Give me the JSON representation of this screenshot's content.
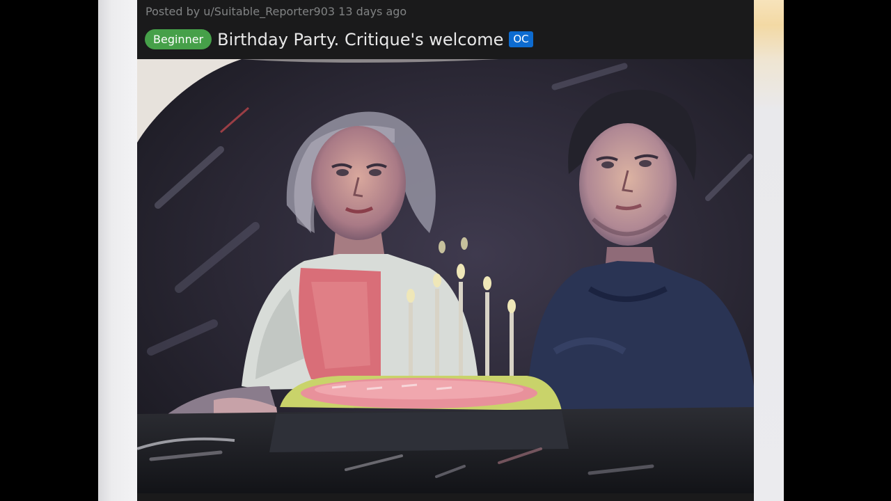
{
  "post": {
    "meta": "Posted by u/Suitable_Reporter903 13 days ago",
    "flair": "Beginner",
    "title": "Birthday Party. Critique's welcome",
    "oc_badge": "OC"
  },
  "colors": {
    "post_background": "#1a1a1b",
    "meta_text": "#818384",
    "flair_background": "#46a049",
    "oc_background": "#0d6bd0",
    "title_text": "#e8e8e8"
  }
}
